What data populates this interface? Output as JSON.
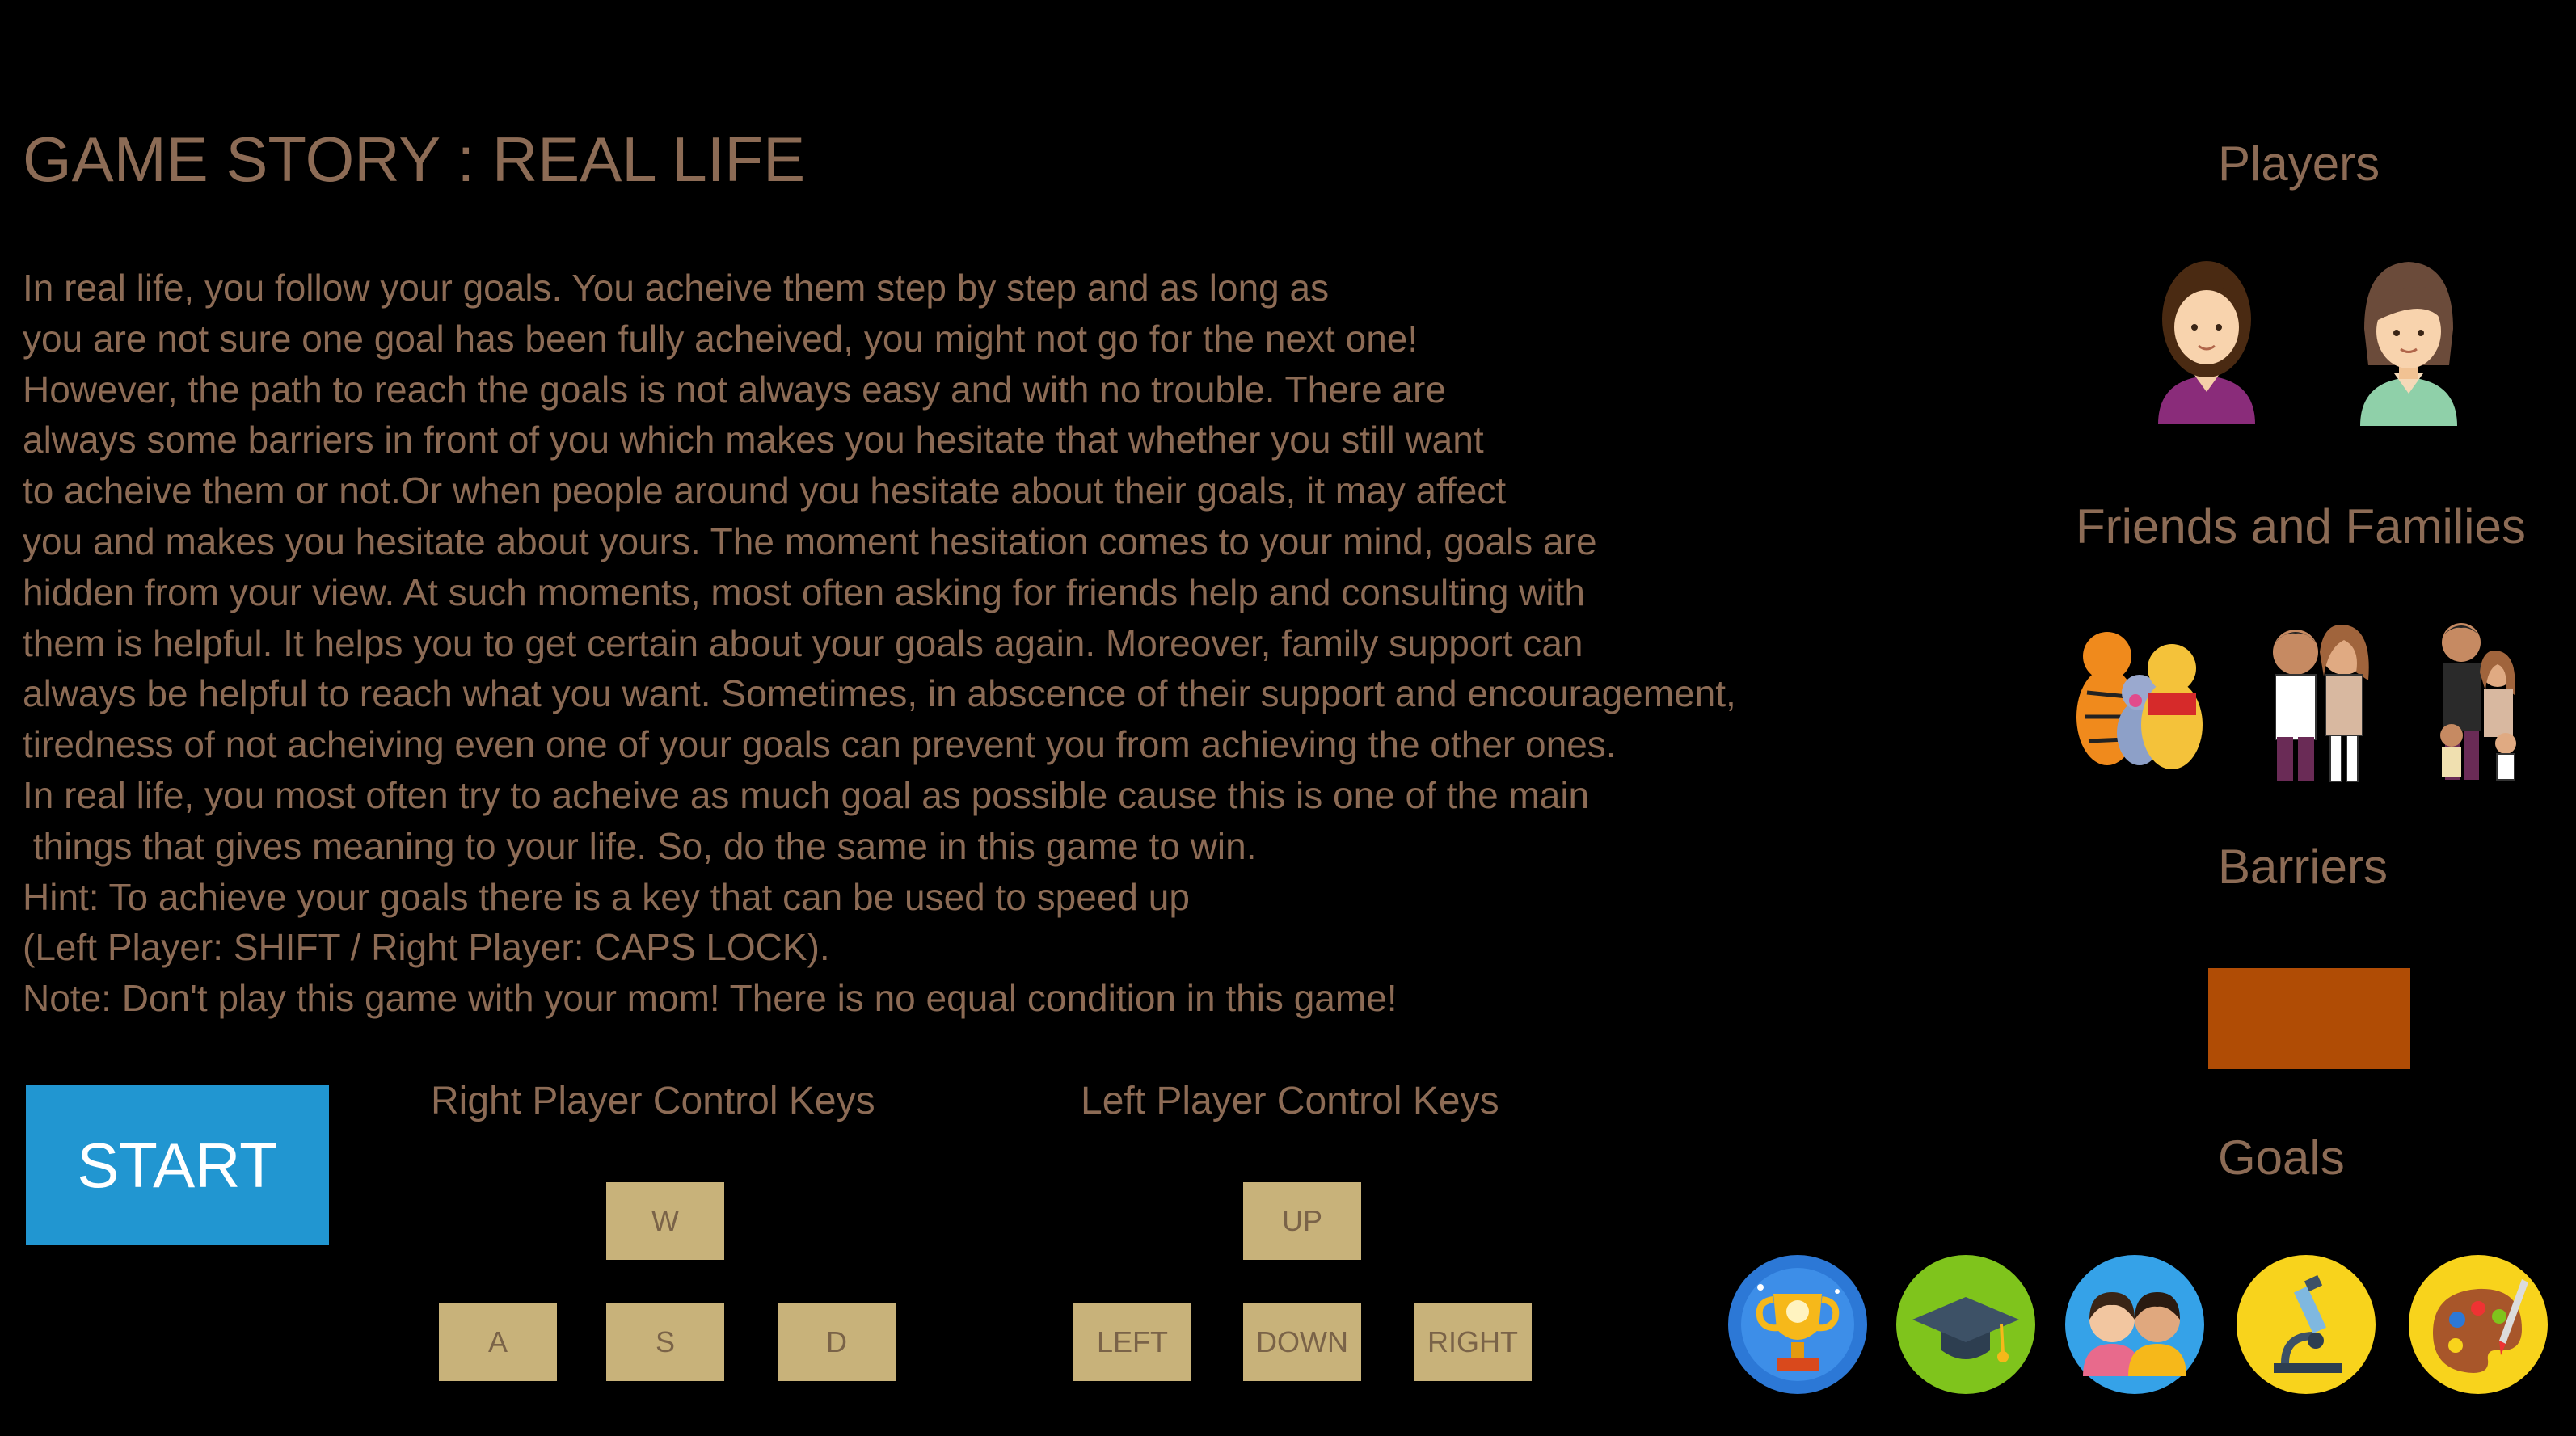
{
  "title": "GAME STORY : REAL LIFE",
  "story_lines": [
    "In real life, you follow your goals. You acheive them step by step and as long as",
    "you are not sure one goal has been fully acheived, you might not go for the next one!",
    "However, the path to reach the goals is not always easy and with no trouble. There are",
    "always some barriers in front of you which makes you hesitate that whether you still want",
    "to acheive them or not.Or when people around you hesitate about their goals, it may affect",
    "you and makes you hesitate about yours. The moment hesitation comes to your mind, goals are",
    "hidden from your view. At such moments, most often asking for friends help and consulting with",
    "them is helpful. It helps you to get certain about your goals again. Moreover, family support can",
    "always be helpful to reach what you want. Sometimes, in abscence of their support and encouragement,",
    "tiredness of not acheiving even one of your goals can prevent you from achieving the other ones.",
    "In real life, you most often try to acheive as much goal as possible cause this is one of the main",
    " things that gives meaning to your life. So, do the same in this game to win.",
    "Hint: To achieve your goals there is a key that can be used to speed up",
    "(Left Player: SHIFT / Right Player: CAPS LOCK).",
    "Note: Don't play this game with your mom! There is no equal condition in this game!"
  ],
  "start_label": "START",
  "controls": {
    "right_title": "Right Player Control Keys",
    "right_keys": {
      "up": "W",
      "left": "A",
      "down": "S",
      "right": "D"
    },
    "left_title": "Left Player Control Keys",
    "left_keys": {
      "up": "UP",
      "left": "LEFT",
      "down": "DOWN",
      "right": "RIGHT"
    }
  },
  "sidebar": {
    "players_title": "Players",
    "players": [
      "curly-hair-player-icon",
      "short-hair-player-icon"
    ],
    "friends_title": "Friends and Families",
    "friends": [
      "pooh-friends-icon",
      "couple-family-icon",
      "family-with-kids-icon"
    ],
    "barriers_title": "Barriers",
    "barrier_color": "#b04c05",
    "goals_title": "Goals",
    "goals": [
      "trophy-icon",
      "graduation-cap-icon",
      "children-icon",
      "microscope-icon",
      "art-palette-icon"
    ]
  },
  "colors": {
    "background": "#000000",
    "text": "#8c6b55",
    "start_button": "#2196d1",
    "key": "#c8b27a"
  }
}
